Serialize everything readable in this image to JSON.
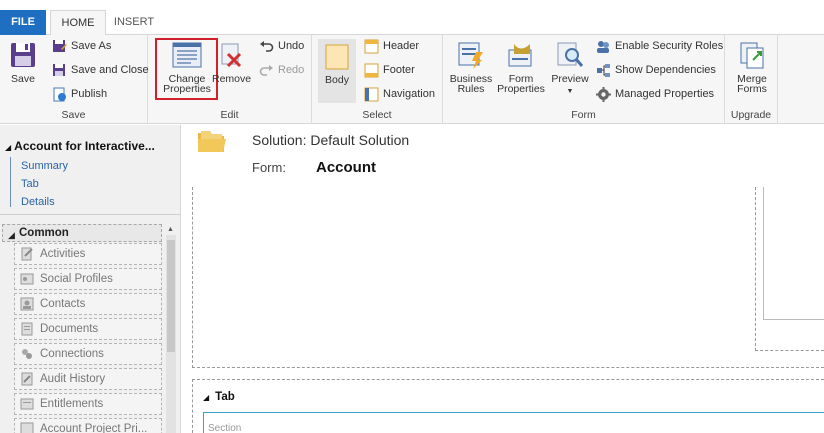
{
  "tabs": {
    "file": "FILE",
    "home": "HOME",
    "insert": "INSERT"
  },
  "ribbon": {
    "save_group": {
      "label": "Save",
      "save": "Save",
      "save_as": "Save As",
      "save_and_close": "Save and Close",
      "publish": "Publish"
    },
    "edit_group": {
      "label": "Edit",
      "change_properties_line1": "Change",
      "change_properties_line2": "Properties",
      "remove": "Remove",
      "undo": "Undo",
      "redo": "Redo"
    },
    "select_group": {
      "label": "Select",
      "body": "Body",
      "header": "Header",
      "footer": "Footer",
      "navigation": "Navigation"
    },
    "form_group": {
      "label": "Form",
      "business_rules_line1": "Business",
      "business_rules_line2": "Rules",
      "form_properties_line1": "Form",
      "form_properties_line2": "Properties",
      "preview": "Preview",
      "enable_security_roles": "Enable Security Roles",
      "show_dependencies": "Show Dependencies",
      "managed_properties": "Managed Properties"
    },
    "upgrade_group": {
      "label": "Upgrade",
      "merge_forms_line1": "Merge",
      "merge_forms_line2": "Forms"
    }
  },
  "leftnav": {
    "title": "Account for Interactive...",
    "links": [
      "Summary",
      "Tab",
      "Details"
    ],
    "section": "Common",
    "items": [
      "Activities",
      "Social Profiles",
      "Contacts",
      "Documents",
      "Connections",
      "Audit History",
      "Entitlements",
      "Account Project Pri..."
    ]
  },
  "main": {
    "solution": "Solution: Default Solution",
    "form_label": "Form:",
    "form_name": "Account",
    "tab_title": "Tab",
    "section_text": "Section"
  },
  "colors": {
    "accent": "#1e6fc1",
    "highlight": "#d0202c",
    "link": "#2a64a8",
    "section_border": "#3aa0d4"
  }
}
